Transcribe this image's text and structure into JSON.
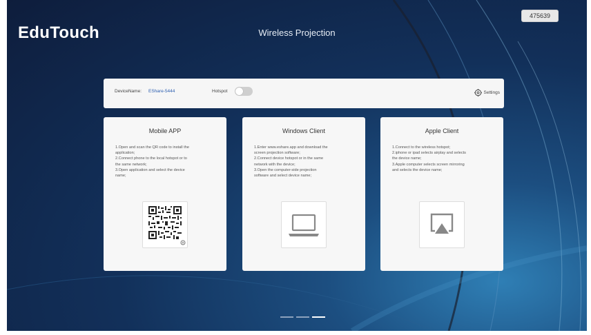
{
  "app": {
    "logo": "EduTouch",
    "title": "Wireless Projection",
    "code_badge": "475639"
  },
  "bar": {
    "device_label": "DeviceName:",
    "device_value": "EShare-5444",
    "hotspot_label": "Hotspot",
    "hotspot_on": false,
    "settings_label": "Settings",
    "settings_icon": "gear-icon"
  },
  "cards": [
    {
      "title": "Mobile APP",
      "lines": [
        "1.Open and scan the QR code to install the",
        "application;",
        "2.Connect phone to the local hotspot or to",
        "the same network;",
        "3.Open application and select the device",
        "name;"
      ],
      "icon": "qr-code-icon"
    },
    {
      "title": "Windows Client",
      "lines": [
        "1.Enter www.eshare.app and download the",
        "screen projection software;",
        "2.Connect device hotspot or in the same",
        "network with the device;",
        "3.Open the computer-side projection",
        "software and select device name;"
      ],
      "icon": "laptop-icon"
    },
    {
      "title": "Apple Client",
      "lines": [
        "1.Connect to the wireless hotspot;",
        "2.iphone or ipad selects airplay and selects",
        "the device name;",
        "3.Apple computer selects screen mirroring",
        "and selects the device name;"
      ],
      "icon": "airplay-icon"
    }
  ],
  "pager": {
    "count": 3,
    "active_index": 2
  }
}
